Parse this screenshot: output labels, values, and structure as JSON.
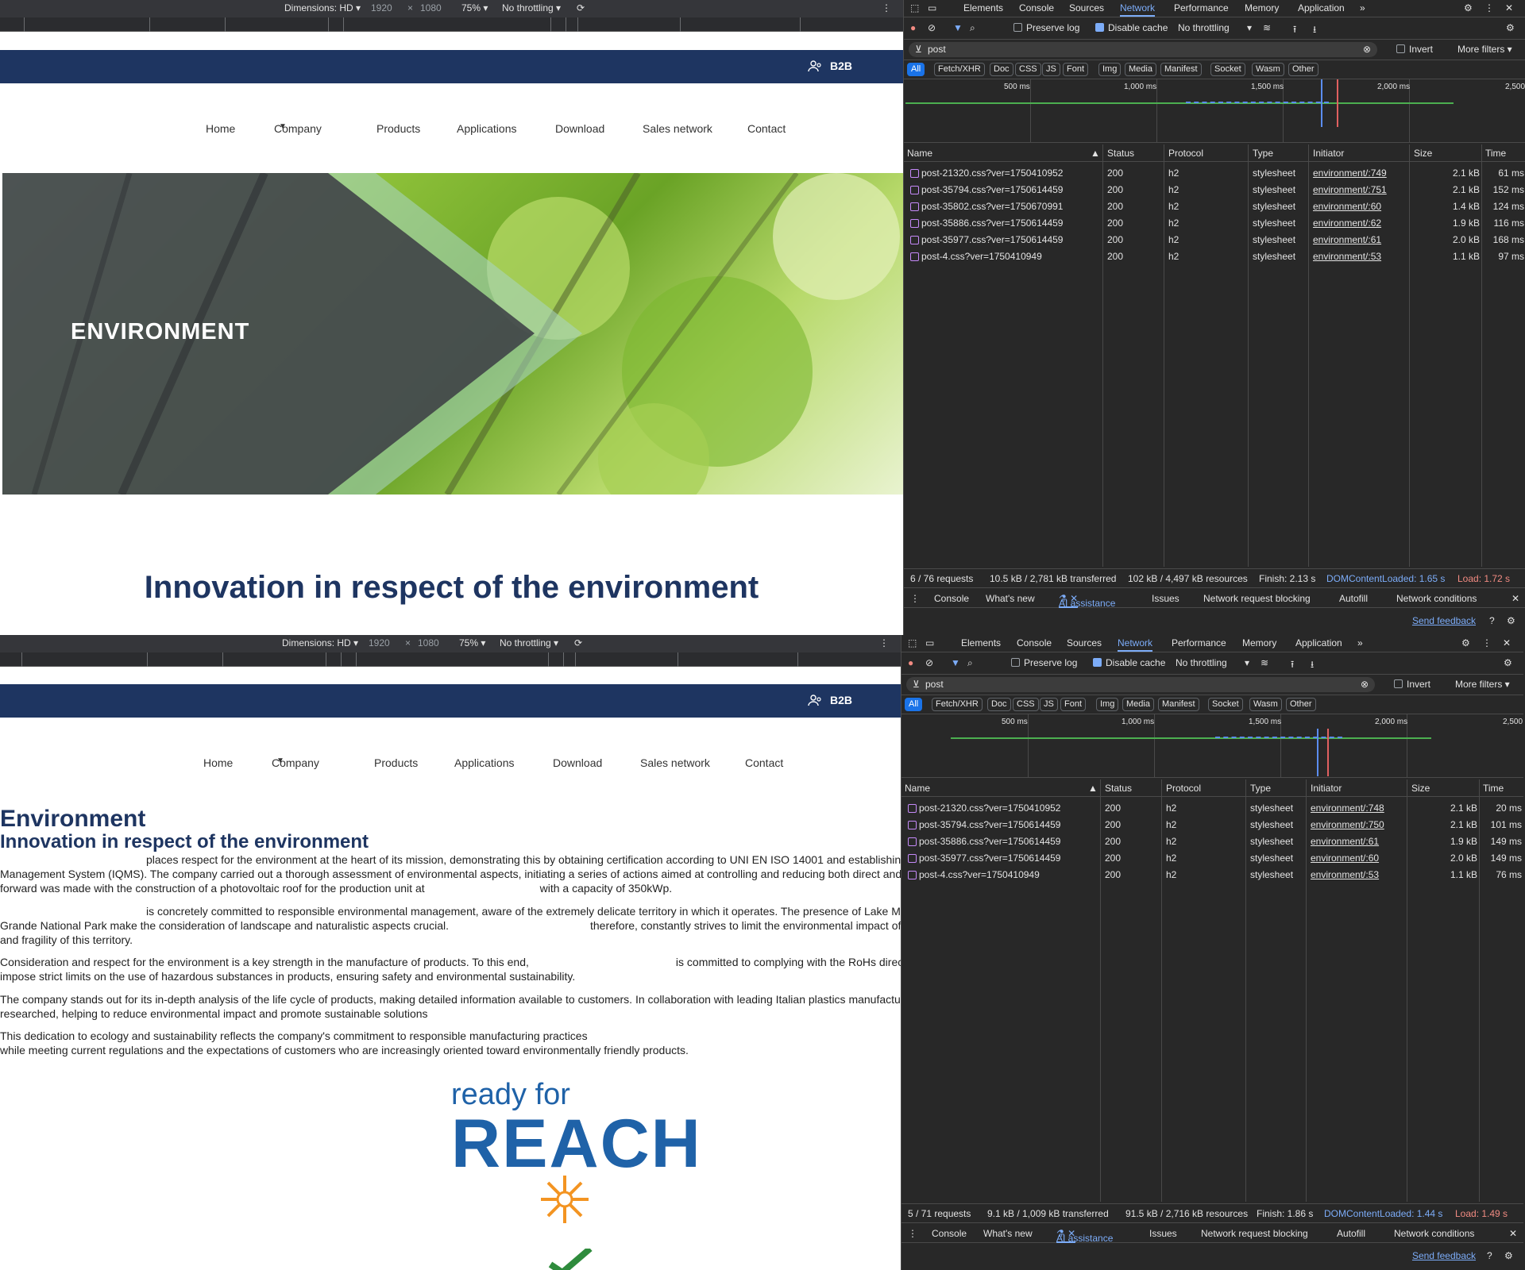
{
  "device_toolbar": {
    "dimensions_label": "Dimensions: HD",
    "width": "1920",
    "times": "×",
    "height": "1080",
    "zoom": "75%",
    "throttle": "No throttling"
  },
  "site": {
    "b2b_label": "B2B",
    "nav": [
      "Home",
      "Company",
      "Products",
      "Applications",
      "Download",
      "Sales network",
      "Contact"
    ],
    "hero_title": "ENVIRONMENT",
    "tagline": "Innovation in respect of the environment",
    "brand_color": "#1e3561"
  },
  "site_bottom": {
    "h1": "Environment",
    "h2": "Innovation in respect of the environment",
    "paragraphs": [
      [
        "places respect for the environment at the heart of its mission, demonstrating this by obtaining certification according to UNI EN ISO 14001 and establishing",
        "Management System (IQMS). The company carried out a thorough assessment of environmental aspects, initiating a series of actions aimed at controlling and reducing both direct and inc",
        "forward was made with the construction of a photovoltaic roof for the production unit at",
        "with a capacity of 350kWp."
      ],
      [
        "is concretely committed to responsible environmental management, aware of the extremely delicate territory in which it operates. The presence of Lake Magg",
        "Grande National Park make the consideration of landscape and naturalistic aspects crucial.",
        "therefore, constantly strives to limit the environmental impact of its",
        "and fragility of this territory."
      ],
      [
        "Consideration and respect for the environment is a key strength in the manufacture of products. To this end,",
        "is committed to complying with the RoHs directi",
        "impose strict limits on the use of hazardous substances in products, ensuring safety and environmental sustainability."
      ],
      [
        "The company stands out for its in-depth analysis of the life cycle of products, making detailed information available to customers. In collaboration with leading Italian plastics manufacturers",
        "researched, helping to reduce environmental impact and promote sustainable solutions"
      ],
      [
        "This dedication to ecology and sustainability reflects the company's commitment to responsible manufacturing practices",
        "while meeting current regulations and the expectations of customers who are increasingly oriented toward environmentally friendly products."
      ]
    ],
    "reach_top": "ready for",
    "reach_bottom": "REACH"
  },
  "devtools": {
    "tabs": [
      "Elements",
      "Console",
      "Sources",
      "Network",
      "Performance",
      "Memory",
      "Application"
    ],
    "active_tab": "Network",
    "preserve_log": "Preserve log",
    "disable_cache": "Disable cache",
    "throttling": "No throttling",
    "filter_value": "post",
    "invert": "Invert",
    "more_filters": "More filters",
    "type_chips": [
      "All",
      "Fetch/XHR",
      "Doc",
      "CSS",
      "JS",
      "Font",
      "Img",
      "Media",
      "Manifest",
      "Socket",
      "Wasm",
      "Other"
    ],
    "timeline_marks": [
      "500 ms",
      "1,000 ms",
      "1,500 ms",
      "2,000 ms",
      "2,500"
    ],
    "columns": [
      "Name",
      "Status",
      "Protocol",
      "Type",
      "Initiator",
      "Size",
      "Time"
    ],
    "drawer_tabs": [
      "Console",
      "What's new",
      "AI assistance",
      "Issues",
      "Network request blocking",
      "Autofill",
      "Network conditions"
    ],
    "send_feedback": "Send feedback",
    "accent": "#7cacf8"
  },
  "network_top": {
    "rows": [
      [
        "post-21320.css?ver=1750410952",
        "200",
        "h2",
        "stylesheet",
        "environment/:749",
        "2.1 kB",
        "61 ms"
      ],
      [
        "post-35794.css?ver=1750614459",
        "200",
        "h2",
        "stylesheet",
        "environment/:751",
        "2.1 kB",
        "152 ms"
      ],
      [
        "post-35802.css?ver=1750670991",
        "200",
        "h2",
        "stylesheet",
        "environment/:60",
        "1.4 kB",
        "124 ms"
      ],
      [
        "post-35886.css?ver=1750614459",
        "200",
        "h2",
        "stylesheet",
        "environment/:62",
        "1.9 kB",
        "116 ms"
      ],
      [
        "post-35977.css?ver=1750614459",
        "200",
        "h2",
        "stylesheet",
        "environment/:61",
        "2.0 kB",
        "168 ms"
      ],
      [
        "post-4.css?ver=1750410949",
        "200",
        "h2",
        "stylesheet",
        "environment/:53",
        "1.1 kB",
        "97 ms"
      ]
    ],
    "summary": [
      "6 / 76 requests",
      "10.5 kB / 2,781 kB transferred",
      "102 kB / 4,497 kB resources",
      "Finish: 2.13 s",
      "DOMContentLoaded: 1.65 s",
      "Load: 1.72 s"
    ]
  },
  "network_bottom": {
    "rows": [
      [
        "post-21320.css?ver=1750410952",
        "200",
        "h2",
        "stylesheet",
        "environment/:748",
        "2.1 kB",
        "20 ms"
      ],
      [
        "post-35794.css?ver=1750614459",
        "200",
        "h2",
        "stylesheet",
        "environment/:750",
        "2.1 kB",
        "101 ms"
      ],
      [
        "post-35886.css?ver=1750614459",
        "200",
        "h2",
        "stylesheet",
        "environment/:61",
        "1.9 kB",
        "149 ms"
      ],
      [
        "post-35977.css?ver=1750614459",
        "200",
        "h2",
        "stylesheet",
        "environment/:60",
        "2.0 kB",
        "149 ms"
      ],
      [
        "post-4.css?ver=1750410949",
        "200",
        "h2",
        "stylesheet",
        "environment/:53",
        "1.1 kB",
        "76 ms"
      ]
    ],
    "summary": [
      "5 / 71 requests",
      "9.1 kB / 1,009 kB transferred",
      "91.5 kB / 2,716 kB resources",
      "Finish: 1.86 s",
      "DOMContentLoaded: 1.44 s",
      "Load: 1.49 s"
    ]
  }
}
